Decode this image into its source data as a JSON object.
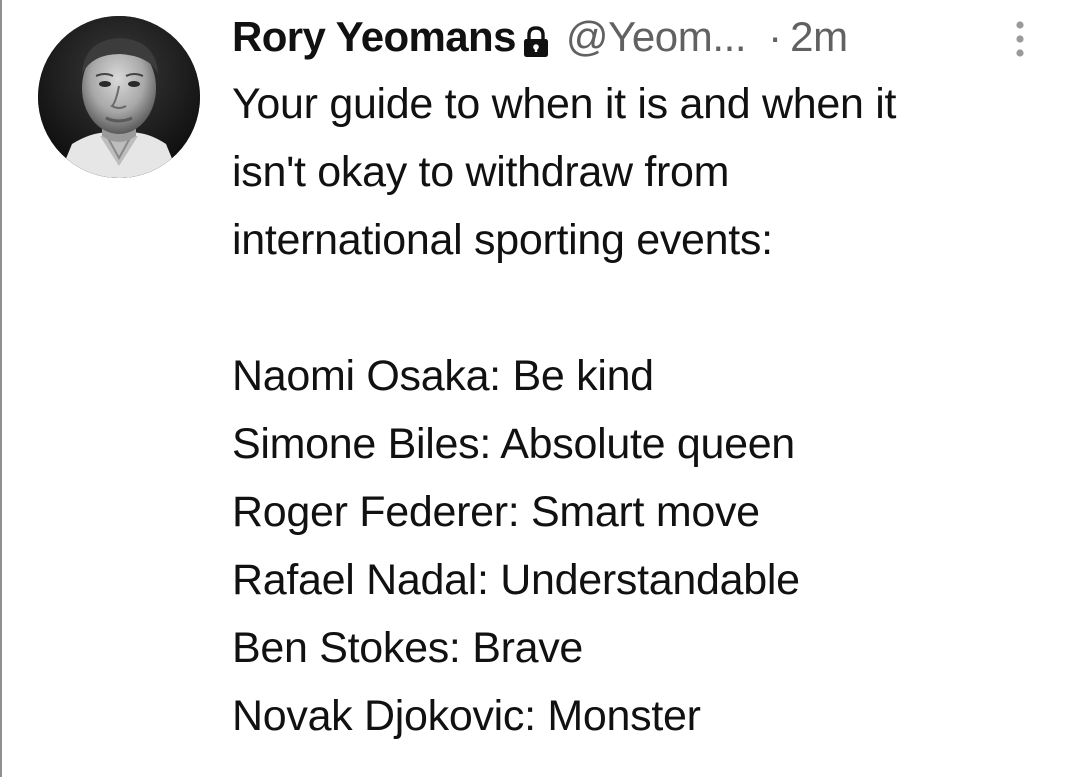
{
  "tweet": {
    "author": {
      "display_name": "Rory Yeomans",
      "handle": "@Yeom...",
      "protected_icon": "lock-icon"
    },
    "separator": "·",
    "timestamp": "2m",
    "more_icon": "more-vertical-icon",
    "intro_lines": [
      "Your guide to when it is and when it",
      "isn't okay to withdraw from",
      "international sporting events:"
    ],
    "list_lines": [
      "Naomi Osaka: Be kind",
      "Simone Biles: Absolute queen",
      "Roger Federer: Smart move",
      "Rafael Nadal: Understandable",
      "Ben Stokes: Brave",
      "Novak Djokovic: Monster"
    ]
  },
  "colors": {
    "text_primary": "#111111",
    "text_secondary": "#616161",
    "background": "#ffffff"
  }
}
